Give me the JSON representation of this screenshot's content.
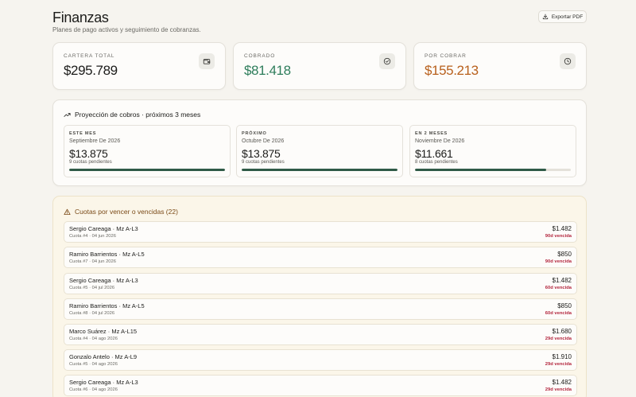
{
  "header": {
    "title": "Finanzas",
    "subtitle": "Planes de pago activos y seguimiento de cobranzas.",
    "export_label": "Exportar PDF"
  },
  "kpis": [
    {
      "label": "CARTERA TOTAL",
      "value": "$295.789",
      "color": "#1c1c1a",
      "icon": "wallet-icon"
    },
    {
      "label": "COBRADO",
      "value": "$81.418",
      "color": "#2e7d5b",
      "icon": "check-circle-icon"
    },
    {
      "label": "POR COBRAR",
      "value": "$155.213",
      "color": "#b8601c",
      "icon": "clock-icon"
    }
  ],
  "projection": {
    "title": "Proyección de cobros · próximos 3 meses",
    "months": [
      {
        "tag": "ESTE MES",
        "name": "Septiembre De 2026",
        "amount": "$13.875",
        "count": "9 cuotas pendientes",
        "progress": 1.0
      },
      {
        "tag": "PRÓXIMO",
        "name": "Octubre De 2026",
        "amount": "$13.875",
        "count": "9 cuotas pendientes",
        "progress": 1.0
      },
      {
        "tag": "EN 2 MESES",
        "name": "Noviembre De 2026",
        "amount": "$11.661",
        "count": "8 cuotas pendientes",
        "progress": 0.84
      }
    ]
  },
  "dues": {
    "title": "Cuotas por vencer o vencidas (22)",
    "rows": [
      {
        "name": "Sergio Careaga · Mz A-L3",
        "sub": "Cuota #4 · 04 jun 2026",
        "amount": "$1.482",
        "status": "90d vencida"
      },
      {
        "name": "Ramiro Barrientos · Mz A-L5",
        "sub": "Cuota #7 · 04 jun 2026",
        "amount": "$850",
        "status": "90d vencida"
      },
      {
        "name": "Sergio Careaga · Mz A-L3",
        "sub": "Cuota #5 · 04 jul 2026",
        "amount": "$1.482",
        "status": "60d vencida"
      },
      {
        "name": "Ramiro Barrientos · Mz A-L5",
        "sub": "Cuota #8 · 04 jul 2026",
        "amount": "$850",
        "status": "60d vencida"
      },
      {
        "name": "Marco Suárez · Mz A-L15",
        "sub": "Cuota #4 · 04 ago 2026",
        "amount": "$1.680",
        "status": "29d vencida"
      },
      {
        "name": "Gonzalo Antelo · Mz A-L9",
        "sub": "Cuota #5 · 04 ago 2026",
        "amount": "$1.910",
        "status": "29d vencida"
      },
      {
        "name": "Sergio Careaga · Mz A-L3",
        "sub": "Cuota #6 · 04 ago 2026",
        "amount": "$1.482",
        "status": "29d vencida"
      }
    ]
  }
}
